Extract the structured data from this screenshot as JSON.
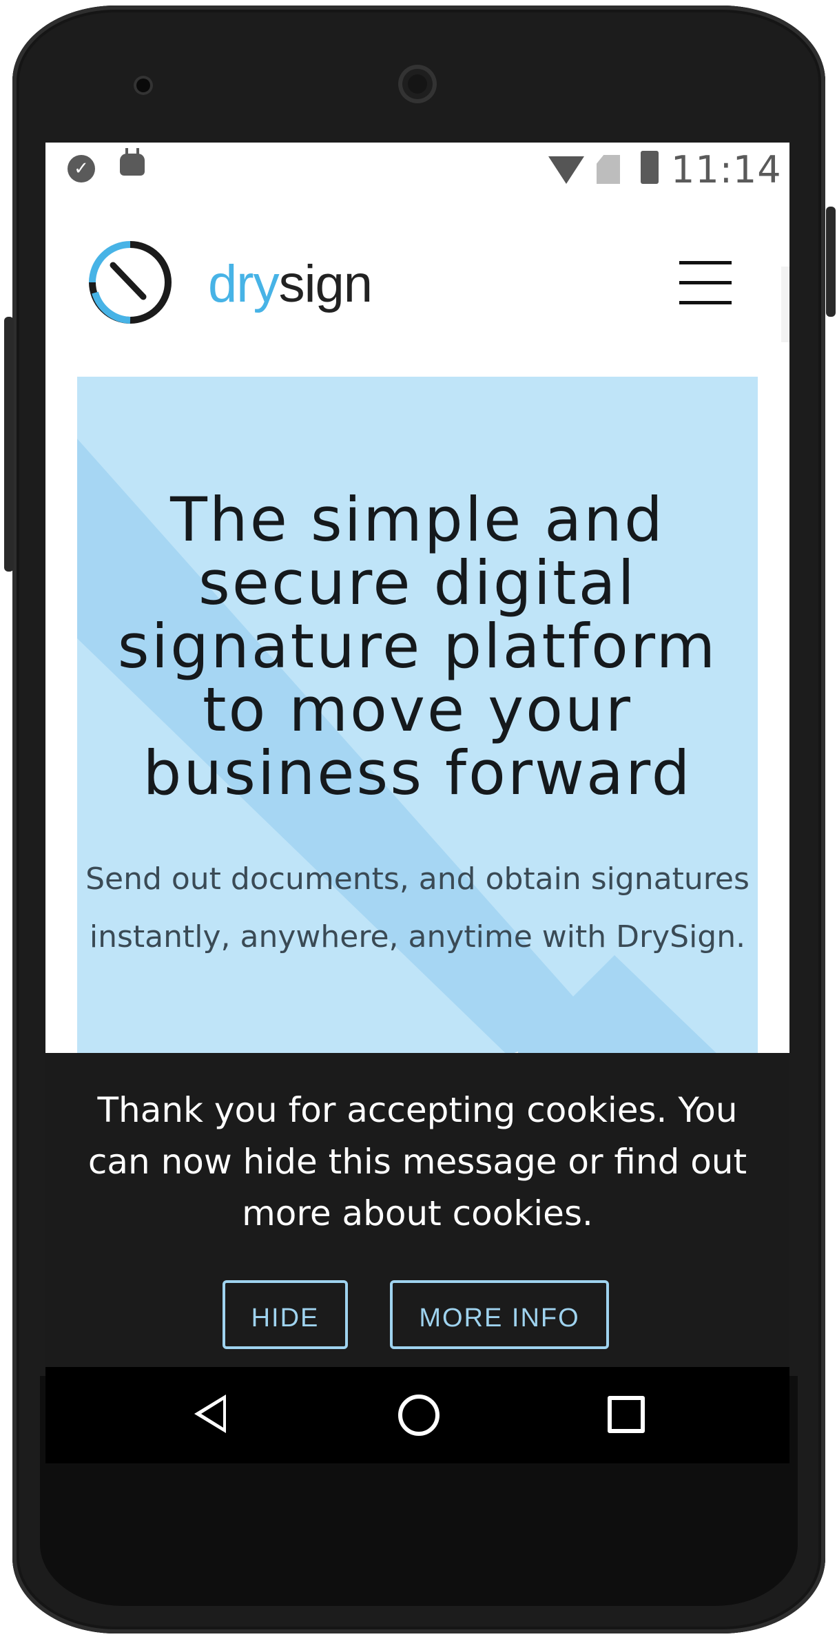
{
  "status_bar": {
    "time": "11:14",
    "icons": [
      "task-check-icon",
      "android-icon",
      "wifi-icon",
      "no-sim-icon",
      "battery-icon"
    ]
  },
  "header": {
    "logo_part1": "dry",
    "logo_part2": "sign",
    "menu_icon": "hamburger-menu-icon"
  },
  "hero": {
    "title": "The simple and secure digital signature platform to move your business forward",
    "subtitle": "Send out documents, and obtain signatures instantly, anywhere, anytime with DrySign."
  },
  "cookie_banner": {
    "message": "Thank you for accepting cookies. You can now hide this message or find out more about cookies.",
    "hide_label": "HIDE",
    "more_info_label": "MORE INFO"
  },
  "nav_bar": {
    "icons": [
      "back-icon",
      "home-icon",
      "recents-icon"
    ]
  },
  "colors": {
    "brand_blue": "#47b3e6",
    "hero_background": "#bfe4f8",
    "cookie_background": "#1b1b1b",
    "button_outline": "#9fd3ef"
  }
}
